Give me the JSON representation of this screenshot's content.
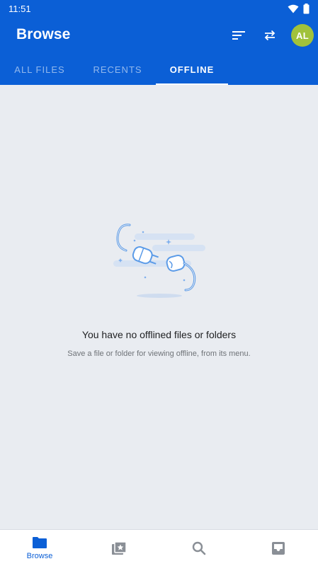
{
  "status": {
    "time": "11:51",
    "icons": [
      "wifi-icon",
      "battery-icon"
    ]
  },
  "header": {
    "title": "Browse",
    "actions": [
      "sort-icon",
      "sync-icon"
    ],
    "avatar_initials": "AL",
    "avatar_color": "#a1c23b"
  },
  "tabs": [
    {
      "label": "ALL FILES",
      "active": false
    },
    {
      "label": "RECENTS",
      "active": false
    },
    {
      "label": "OFFLINE",
      "active": true
    }
  ],
  "empty_state": {
    "illustration": "unplugged-cable-icon",
    "title": "You have no offlined files or folders",
    "subtitle": "Save a file or folder for viewing offline, from its menu."
  },
  "bottom_nav": [
    {
      "icon": "folder-icon",
      "label": "Browse",
      "active": true
    },
    {
      "icon": "starred-photos-icon",
      "label": "",
      "active": false
    },
    {
      "icon": "search-icon",
      "label": "",
      "active": false
    },
    {
      "icon": "inbox-icon",
      "label": "",
      "active": false
    }
  ],
  "colors": {
    "primary": "#0b5fd6",
    "background": "#e9ecf1",
    "inactive_icon": "#8a8f96"
  }
}
